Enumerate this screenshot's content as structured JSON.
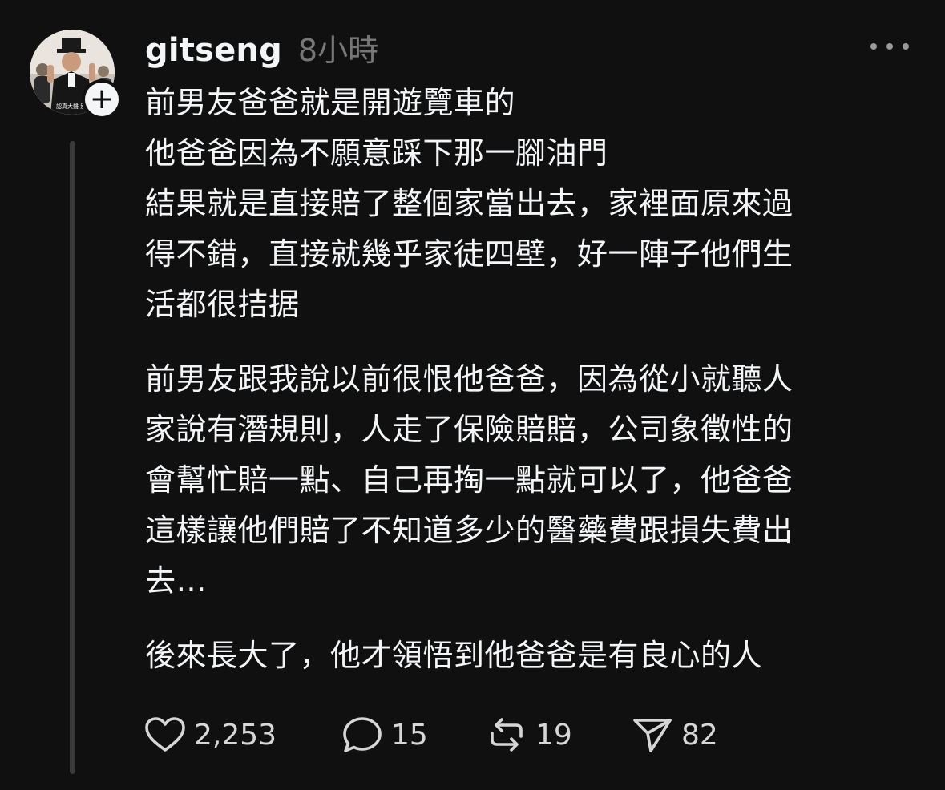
{
  "post": {
    "username": "gitseng",
    "timestamp": "8小時",
    "avatar_caption": "認真大聲 別!",
    "follow_symbol": "+",
    "paragraphs": [
      {
        "lines": [
          "前男友爸爸就是開遊覽車的",
          "他爸爸因為不願意踩下那一腳油門",
          "結果就是直接賠了整個家當出去，家裡面原來過",
          "得不錯，直接就幾乎家徒四壁，好一陣子他們生",
          "活都很拮据"
        ]
      },
      {
        "lines": [
          "前男友跟我說以前很恨他爸爸，因為從小就聽人",
          "家說有潛規則，人走了保險賠賠，公司象徵性的",
          "會幫忙賠一點、自己再掏一點就可以了，他爸爸",
          "這樣讓他們賠了不知道多少的醫藥費跟損失費出",
          "去…"
        ]
      },
      {
        "lines": [
          "後來長大了，他才領悟到他爸爸是有良心的人"
        ]
      }
    ]
  },
  "actions": {
    "like_count": "2,253",
    "reply_count": "15",
    "repost_count": "19",
    "share_count": "82"
  },
  "icons": {
    "like": "heart-icon",
    "reply": "speech-bubble-icon",
    "repost": "repost-arrows-icon",
    "share": "paper-plane-icon",
    "more": "more-dots-icon",
    "follow": "plus-icon"
  },
  "colors": {
    "background": "#101010",
    "text_primary": "#f3f5f7",
    "text_secondary": "#777777",
    "thread_line": "#3a3a3a"
  }
}
